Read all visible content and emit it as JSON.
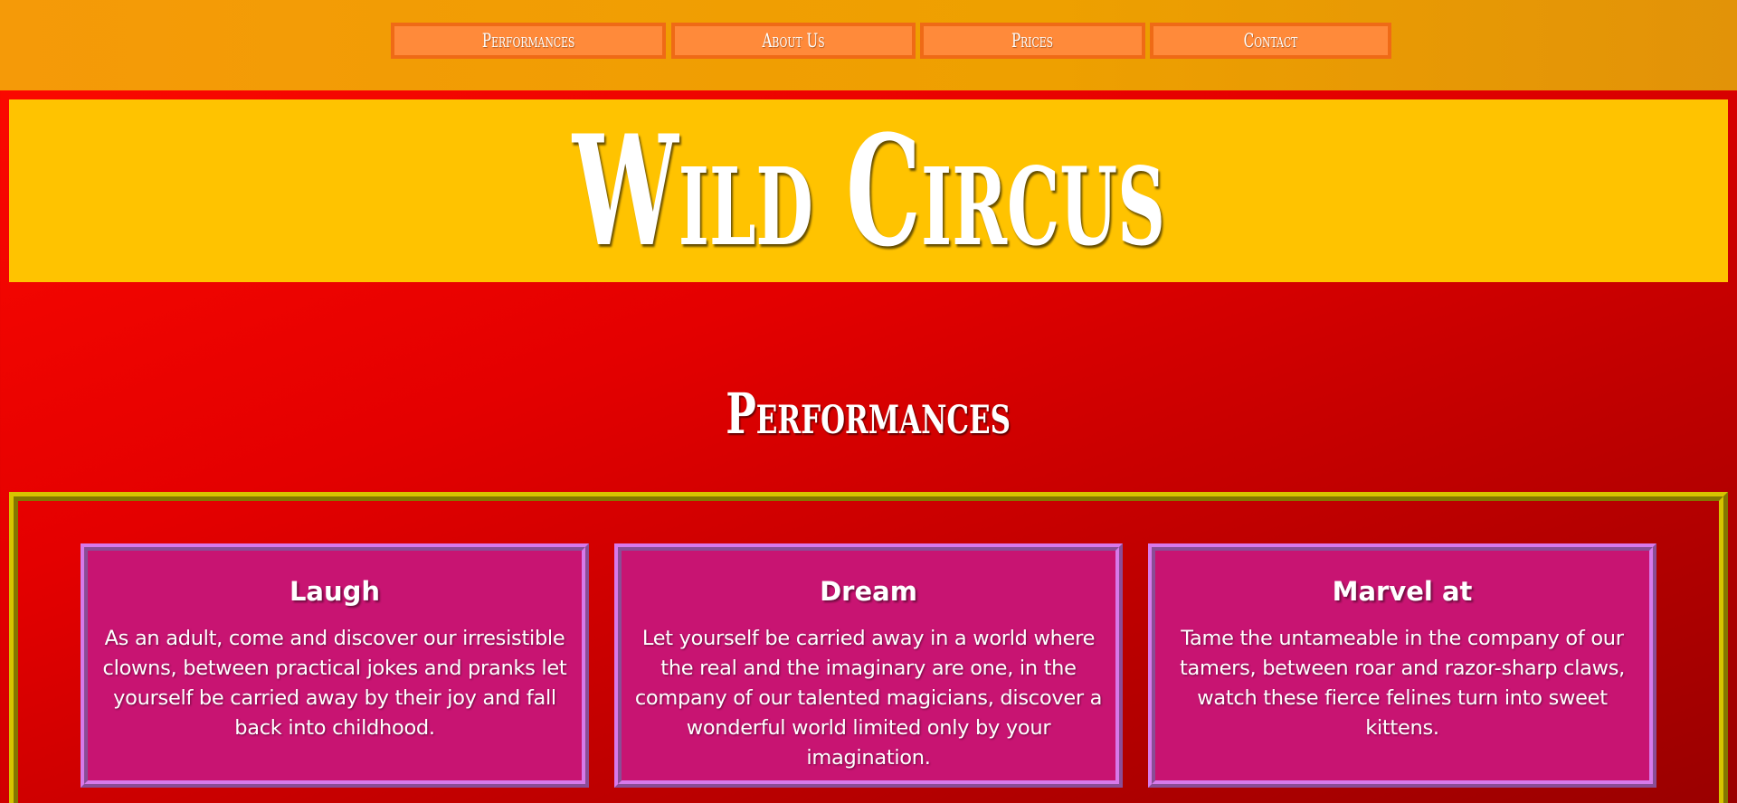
{
  "nav": {
    "items": [
      {
        "label": "Performances"
      },
      {
        "label": "About Us"
      },
      {
        "label": "Prices"
      },
      {
        "label": "Contact"
      }
    ]
  },
  "header": {
    "title": "Wild Circus"
  },
  "performances": {
    "heading": "Performances",
    "cards": [
      {
        "title": "Laugh",
        "text": "As an adult, come and discover our irresistible clowns, between practical jokes and pranks let yourself be carried away by their joy and fall back into childhood."
      },
      {
        "title": "Dream",
        "text": "Let yourself be carried away in a world where the real and the imaginary are one, in the company of our talented magicians, discover a wonderful world limited only by your imagination."
      },
      {
        "title": "Marvel at",
        "text": "Tame the untameable in the company of our tamers, between roar and razor-sharp claws, watch these fierce felines turn into sweet kittens."
      }
    ]
  },
  "colors": {
    "topbar": "#f39a06",
    "nav_button": "#ff8a3a",
    "nav_border": "#ef6a16",
    "banner": "#ffc300",
    "background_red": "#ff0a00",
    "frame_border": "#d7c300",
    "card_background": "#c81472",
    "card_border": "#d779ea"
  }
}
